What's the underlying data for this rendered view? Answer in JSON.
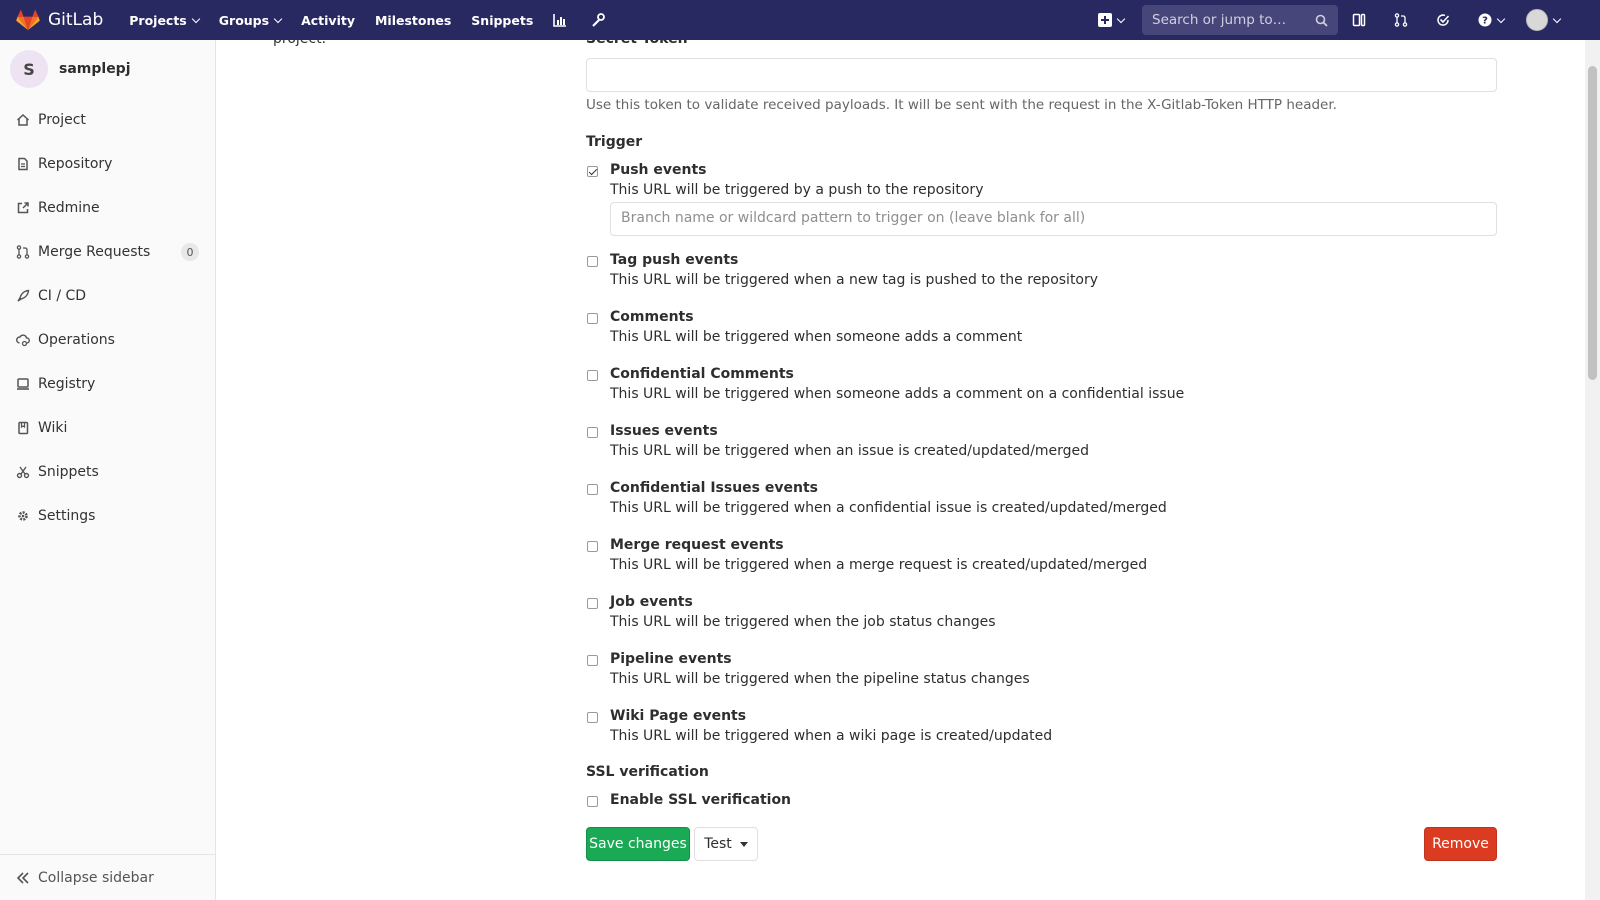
{
  "navbar": {
    "brand": "GitLab",
    "links": [
      {
        "label": "Projects",
        "dropdown": true
      },
      {
        "label": "Groups",
        "dropdown": true
      },
      {
        "label": "Activity",
        "dropdown": false
      },
      {
        "label": "Milestones",
        "dropdown": false
      },
      {
        "label": "Snippets",
        "dropdown": false
      }
    ],
    "search_placeholder": "Search or jump to…",
    "colors": {
      "background": "#292961",
      "accent": "#fc6d26"
    }
  },
  "sidebar": {
    "project_initial": "S",
    "project_name": "samplepj",
    "items": [
      {
        "label": "Project",
        "icon": "home-icon"
      },
      {
        "label": "Repository",
        "icon": "doc-icon"
      },
      {
        "label": "Redmine",
        "icon": "external-link-icon"
      },
      {
        "label": "Merge Requests",
        "icon": "merge-request-icon",
        "badge": "0"
      },
      {
        "label": "CI / CD",
        "icon": "rocket-icon"
      },
      {
        "label": "Operations",
        "icon": "cloud-gear-icon"
      },
      {
        "label": "Registry",
        "icon": "monitor-icon"
      },
      {
        "label": "Wiki",
        "icon": "book-icon"
      },
      {
        "label": "Snippets",
        "icon": "scissors-icon"
      },
      {
        "label": "Settings",
        "icon": "gear-icon"
      }
    ],
    "collapse_label": "Collapse sidebar"
  },
  "main": {
    "left_note": "project.",
    "secret_token": {
      "label": "Secret Token",
      "value": "",
      "help": "Use this token to validate received payloads. It will be sent with the request in the X-Gitlab-Token HTTP header."
    },
    "trigger_label": "Trigger",
    "push_branch_placeholder": "Branch name or wildcard pattern to trigger on (leave blank for all)",
    "triggers": [
      {
        "title": "Push events",
        "desc": "This URL will be triggered by a push to the repository",
        "checked": true
      },
      {
        "title": "Tag push events",
        "desc": "This URL will be triggered when a new tag is pushed to the repository",
        "checked": false
      },
      {
        "title": "Comments",
        "desc": "This URL will be triggered when someone adds a comment",
        "checked": false
      },
      {
        "title": "Confidential Comments",
        "desc": "This URL will be triggered when someone adds a comment on a confidential issue",
        "checked": false
      },
      {
        "title": "Issues events",
        "desc": "This URL will be triggered when an issue is created/updated/merged",
        "checked": false
      },
      {
        "title": "Confidential Issues events",
        "desc": "This URL will be triggered when a confidential issue is created/updated/merged",
        "checked": false
      },
      {
        "title": "Merge request events",
        "desc": "This URL will be triggered when a merge request is created/updated/merged",
        "checked": false
      },
      {
        "title": "Job events",
        "desc": "This URL will be triggered when the job status changes",
        "checked": false
      },
      {
        "title": "Pipeline events",
        "desc": "This URL will be triggered when the pipeline status changes",
        "checked": false
      },
      {
        "title": "Wiki Page events",
        "desc": "This URL will be triggered when a wiki page is created/updated",
        "checked": false
      }
    ],
    "ssl_label": "SSL verification",
    "ssl_option": {
      "title": "Enable SSL verification",
      "checked": false
    },
    "buttons": {
      "save": "Save changes",
      "test": "Test",
      "remove": "Remove"
    },
    "colors": {
      "save": "#1aaa55",
      "remove": "#db3b21"
    }
  }
}
